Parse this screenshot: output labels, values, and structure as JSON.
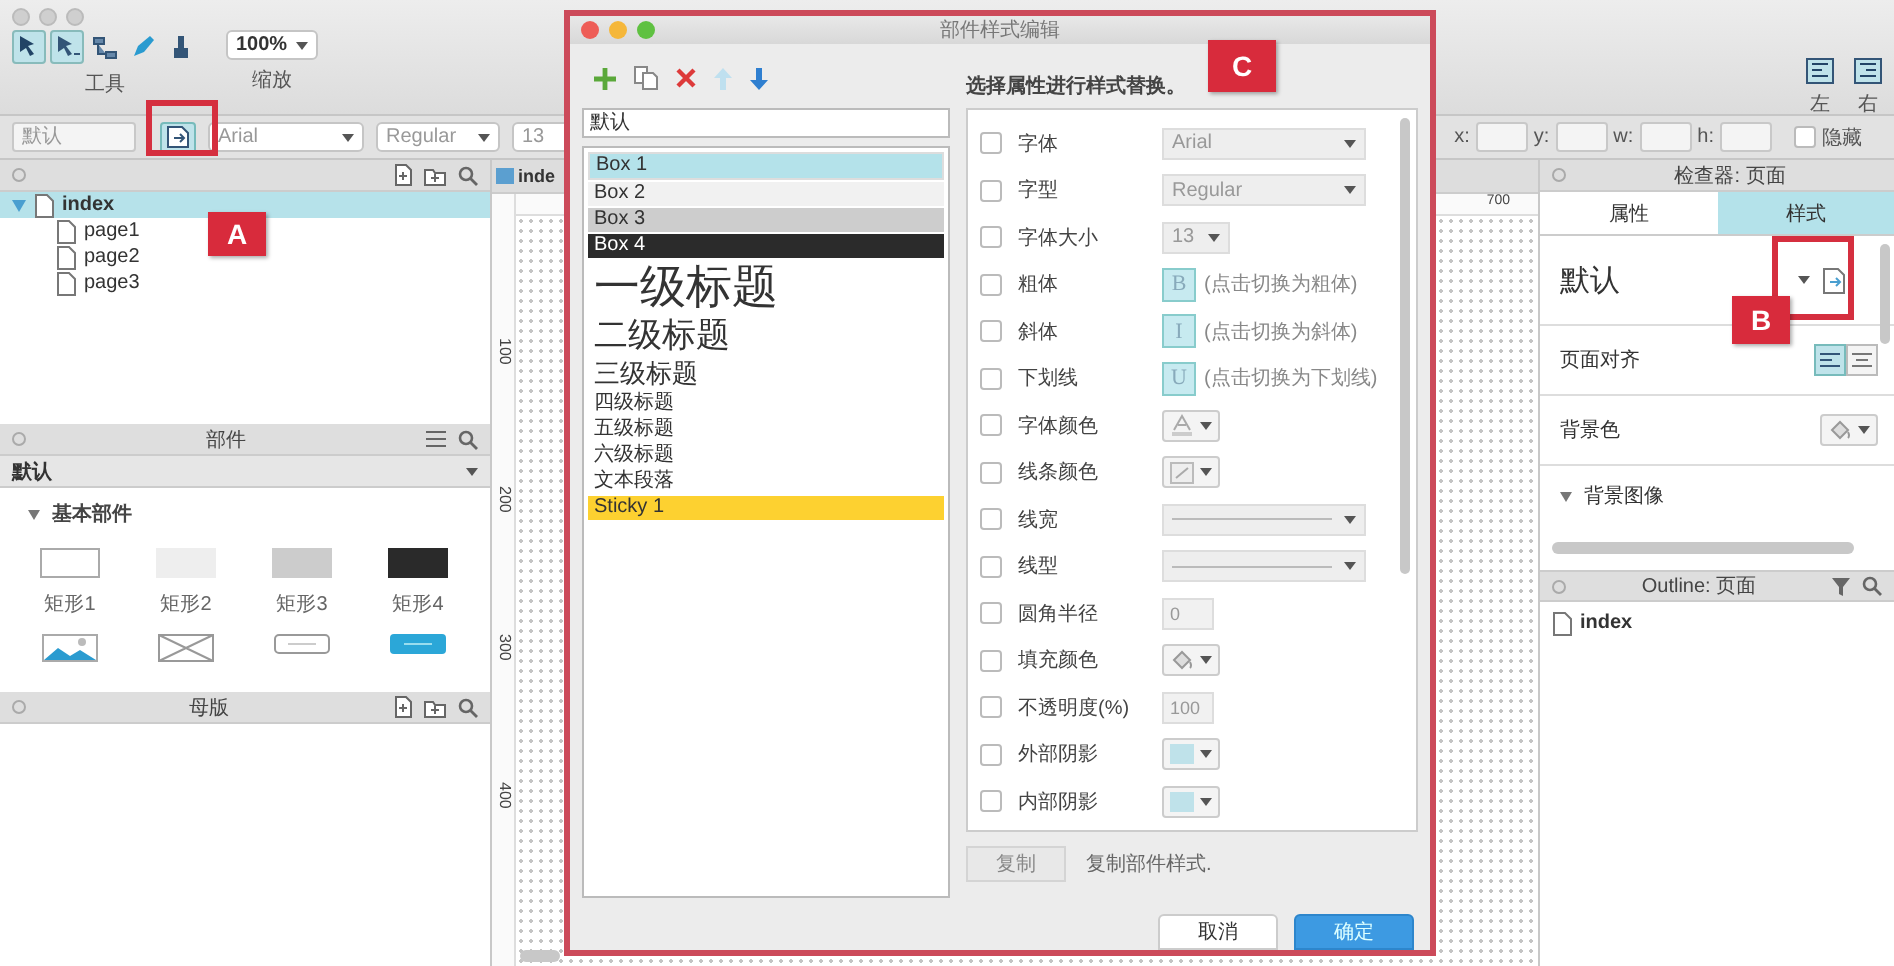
{
  "toolbar": {
    "tools_label": "工具",
    "zoom": "100%",
    "zoom_label": "缩放",
    "style": "默认",
    "font": "Arial",
    "weight": "Regular",
    "size": "13",
    "x_label": "x:",
    "y_label": "y:",
    "w_label": "w:",
    "h_label": "h:",
    "hidden_label": "隐藏",
    "hidden_checked": false,
    "align_left": "左",
    "align_right": "右"
  },
  "pages": {
    "items": [
      {
        "label": "index",
        "expanded": true,
        "selected": true,
        "children": [
          {
            "label": "page1",
            "selected": false
          },
          {
            "label": "page2",
            "selected": false
          },
          {
            "label": "page3",
            "selected": false
          }
        ]
      }
    ]
  },
  "widgets": {
    "title": "部件",
    "library": "默认",
    "section": {
      "label": "基本部件",
      "expanded": true
    },
    "items": [
      {
        "label": "矩形1",
        "kind": "box-white"
      },
      {
        "label": "矩形2",
        "kind": "box-light"
      },
      {
        "label": "矩形3",
        "kind": "box-gray"
      },
      {
        "label": "矩形4",
        "kind": "box-dark"
      }
    ],
    "more_items": [
      {
        "kind": "image"
      },
      {
        "kind": "placeholder"
      },
      {
        "kind": "button"
      },
      {
        "kind": "primary-button"
      }
    ]
  },
  "masters": {
    "title": "母版"
  },
  "canvas": {
    "tab": "inde",
    "ruler_marks": [
      "100",
      "200",
      "300",
      "400"
    ],
    "top_ruler_mark": "700"
  },
  "dialog": {
    "title": "部件样式编辑",
    "style_name": "默认",
    "styles": [
      {
        "label": "Box 1",
        "kind": "box1",
        "selected": true
      },
      {
        "label": "Box 2",
        "kind": "box2",
        "selected": false
      },
      {
        "label": "Box 3",
        "kind": "box3",
        "selected": false
      },
      {
        "label": "Box 4",
        "kind": "box4",
        "selected": false
      },
      {
        "label": "一级标题",
        "kind": "h1",
        "selected": false
      },
      {
        "label": "二级标题",
        "kind": "h2",
        "selected": false
      },
      {
        "label": "三级标题",
        "kind": "h3",
        "selected": false
      },
      {
        "label": "四级标题",
        "kind": "h4",
        "selected": false
      },
      {
        "label": "五级标题",
        "kind": "h5",
        "selected": false
      },
      {
        "label": "六级标题",
        "kind": "h6",
        "selected": false
      },
      {
        "label": "文本段落",
        "kind": "paragraph",
        "selected": false
      },
      {
        "label": "Sticky 1",
        "kind": "sticky",
        "selected": false
      }
    ],
    "instruction": "选择属性进行样式替换。",
    "properties": [
      {
        "label": "字体",
        "checked": false,
        "kind": "select",
        "value": "Arial"
      },
      {
        "label": "字型",
        "checked": false,
        "kind": "select",
        "value": "Regular"
      },
      {
        "label": "字体大小",
        "checked": false,
        "kind": "small-select",
        "value": "13"
      },
      {
        "label": "粗体",
        "checked": false,
        "kind": "toggle",
        "value": "B",
        "hint": "(点击切换为粗体)"
      },
      {
        "label": "斜体",
        "checked": false,
        "kind": "toggle",
        "value": "I",
        "hint": "(点击切换为斜体)"
      },
      {
        "label": "下划线",
        "checked": false,
        "kind": "toggle",
        "value": "U",
        "hint": "(点击切换为下划线)"
      },
      {
        "label": "字体颜色",
        "checked": false,
        "kind": "font-color"
      },
      {
        "label": "线条颜色",
        "checked": false,
        "kind": "line-color"
      },
      {
        "label": "线宽",
        "checked": false,
        "kind": "line-select"
      },
      {
        "label": "线型",
        "checked": false,
        "kind": "line-select"
      },
      {
        "label": "圆角半径",
        "checked": false,
        "kind": "number",
        "value": "0"
      },
      {
        "label": "填充颜色",
        "checked": false,
        "kind": "fill-color"
      },
      {
        "label": "不透明度(%)",
        "checked": false,
        "kind": "number",
        "value": "100"
      },
      {
        "label": "外部阴影",
        "checked": false,
        "kind": "shadow"
      },
      {
        "label": "内部阴影",
        "checked": false,
        "kind": "shadow"
      }
    ],
    "copy_button": "复制",
    "copy_hint": "复制部件样式.",
    "cancel": "取消",
    "ok": "确定"
  },
  "inspector": {
    "title": "检查器: 页面",
    "tabs": [
      {
        "label": "属性",
        "selected": false
      },
      {
        "label": "样式",
        "selected": true
      }
    ],
    "style": "默认",
    "rows": [
      {
        "label": "页面对齐",
        "kind": "align"
      },
      {
        "label": "背景色",
        "kind": "fill-color"
      }
    ],
    "section": {
      "label": "背景图像",
      "expanded": true
    }
  },
  "outline": {
    "title": "Outline: 页面",
    "items": [
      {
        "label": "index"
      }
    ]
  },
  "callouts": [
    {
      "label": "A"
    },
    {
      "label": "B"
    },
    {
      "label": "C"
    }
  ]
}
